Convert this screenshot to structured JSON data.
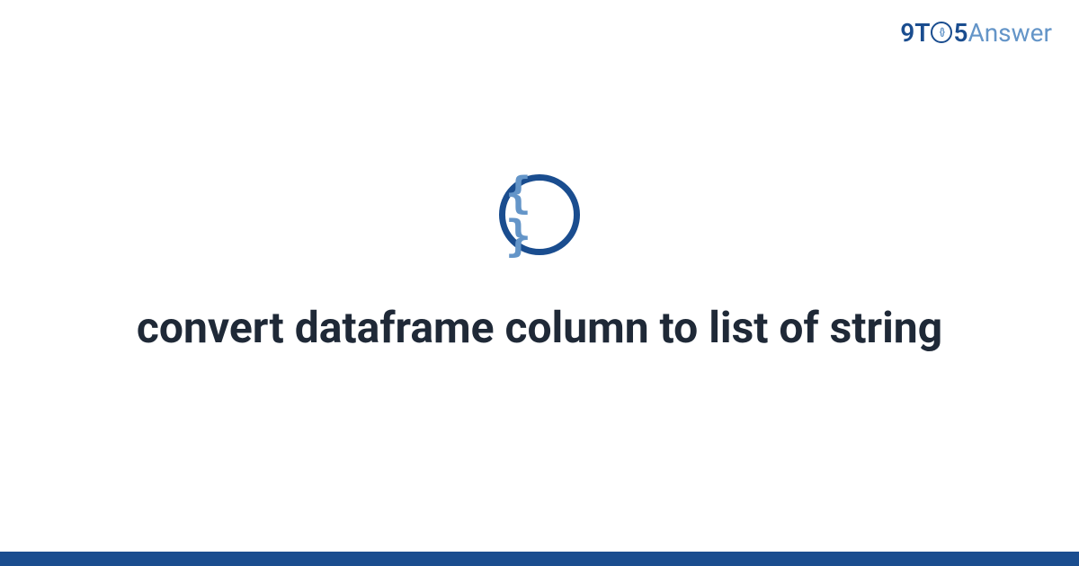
{
  "logo": {
    "part1": "9T",
    "braces_inner": "{}",
    "part2": "5",
    "part3": "Answer"
  },
  "icon": {
    "braces": "{ }"
  },
  "title": "convert dataframe column to list of string",
  "colors": {
    "primary": "#1a4d8f",
    "accent": "#6495c8",
    "text": "#1f2937"
  }
}
